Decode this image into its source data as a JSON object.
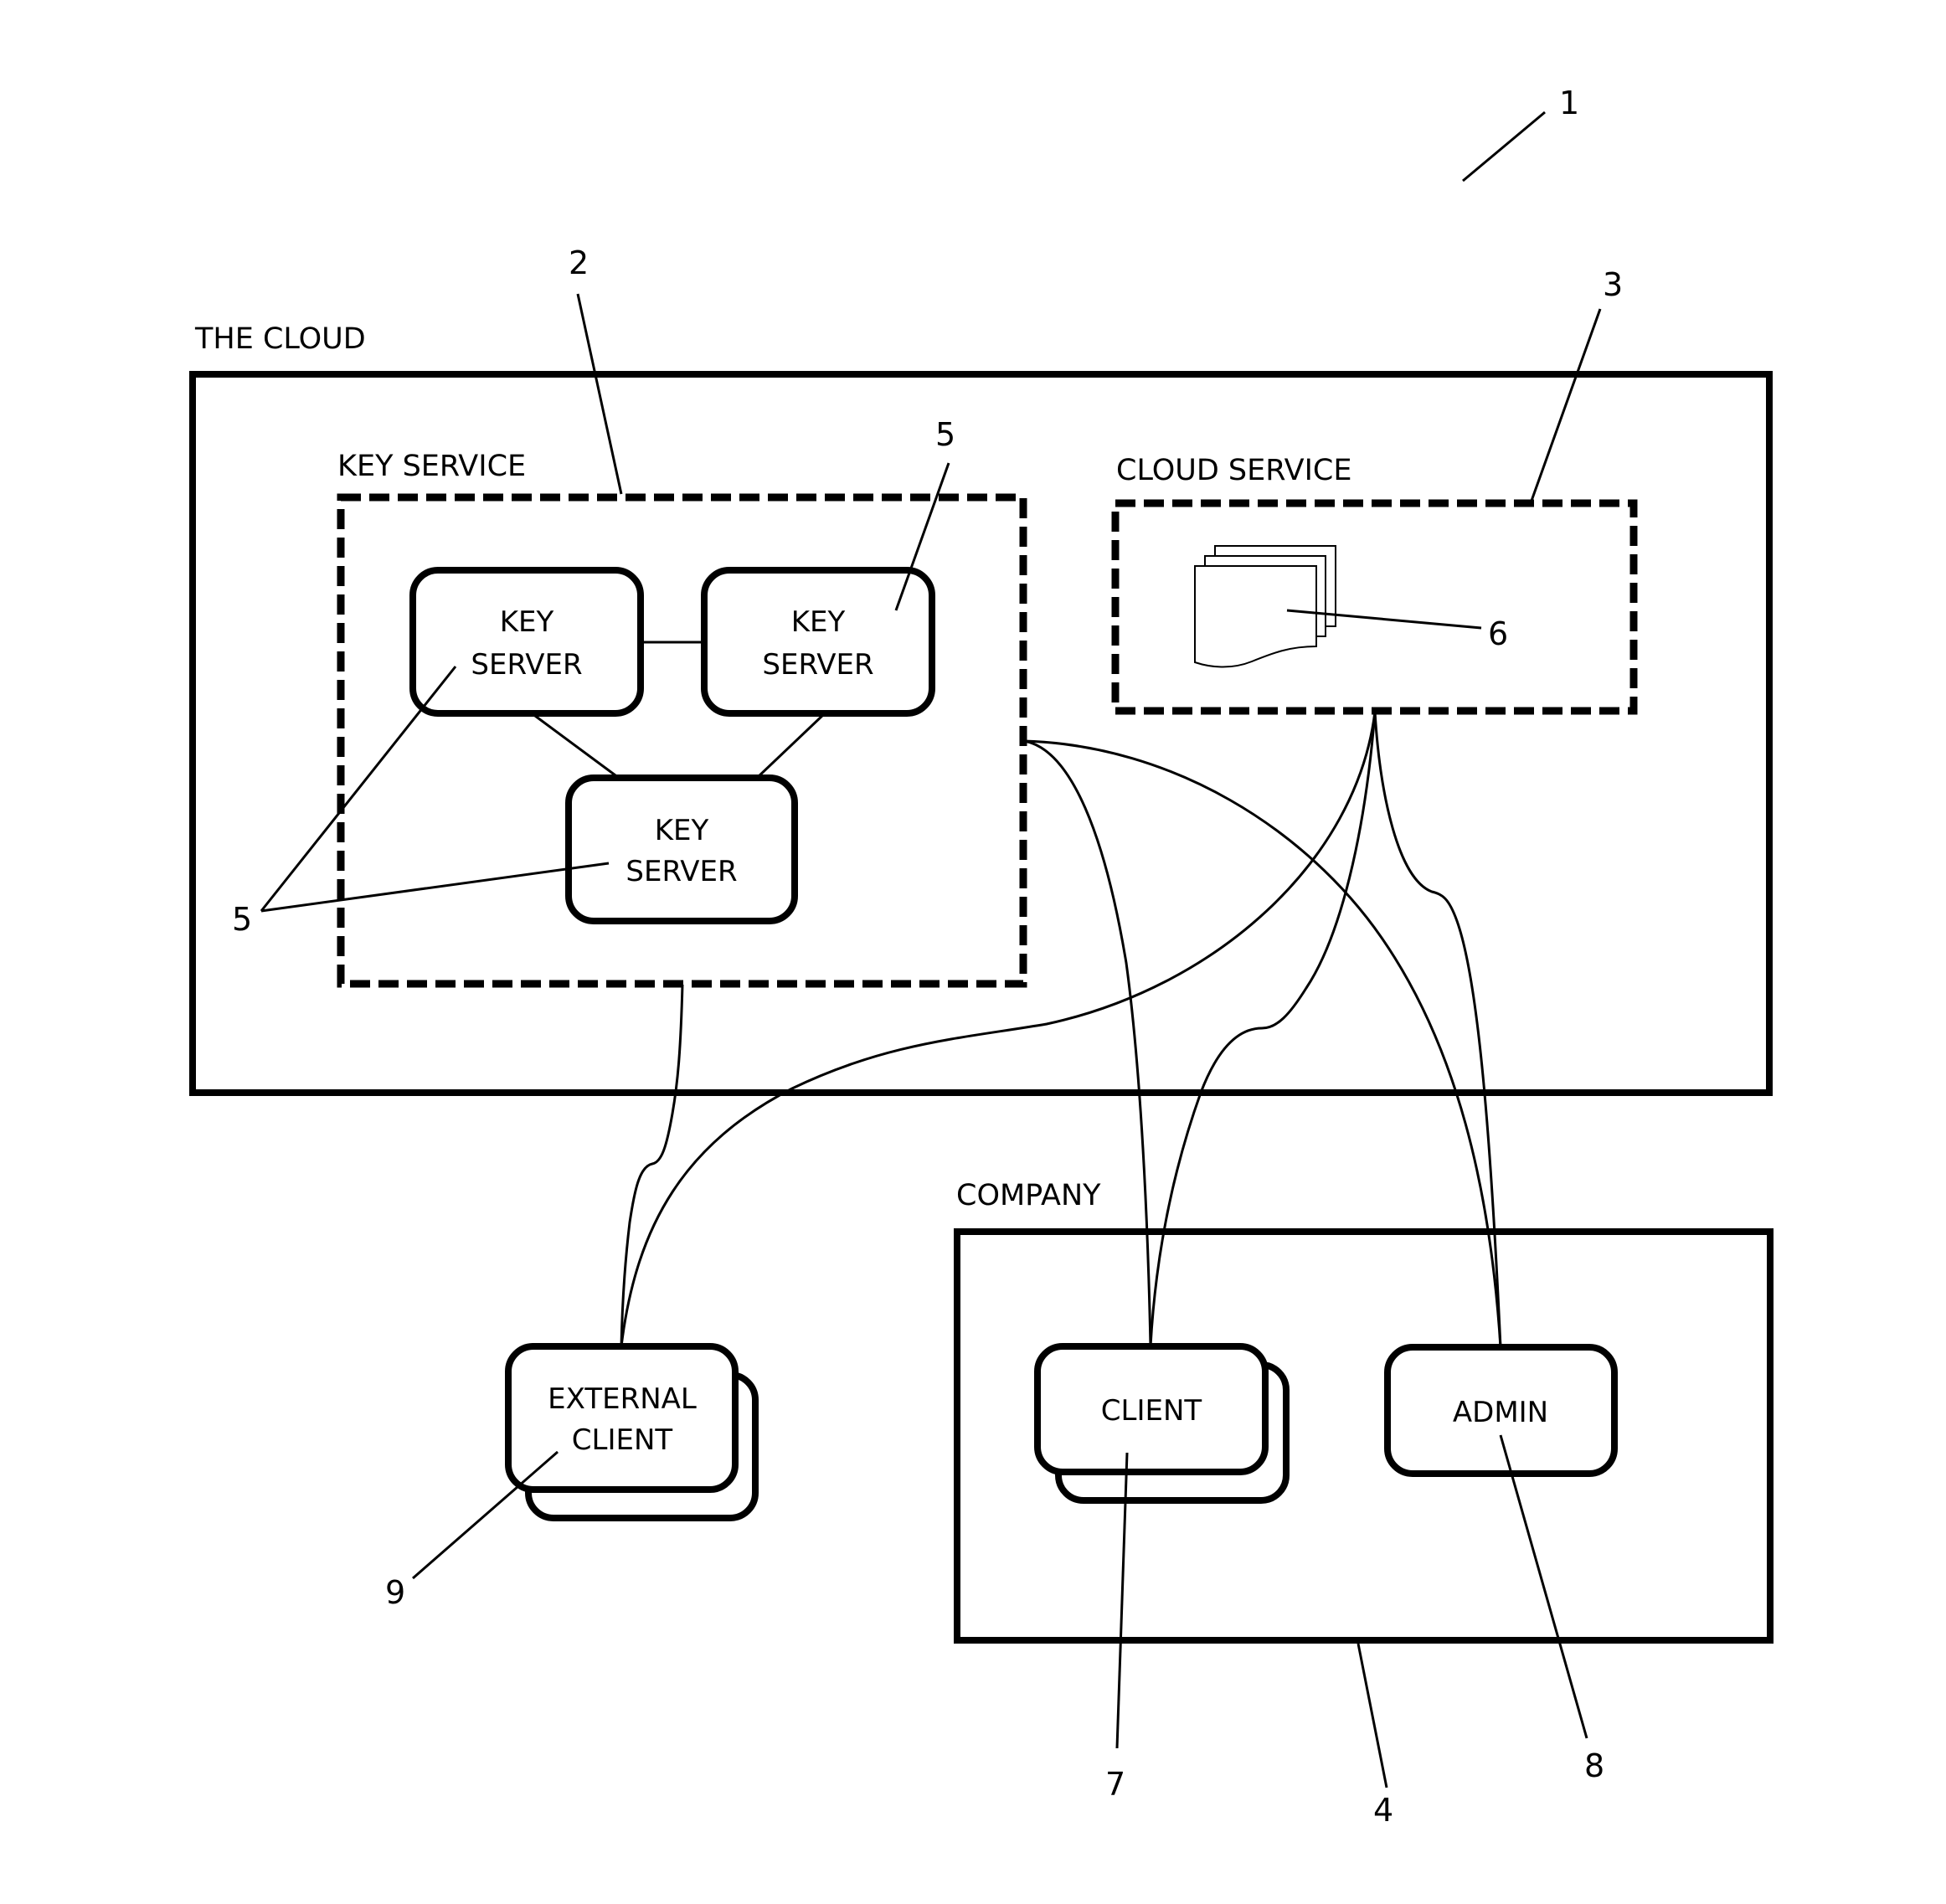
{
  "figure": {
    "reference": "1",
    "cloud": {
      "label": "THE CLOUD",
      "key_service": {
        "label": "KEY SERVICE",
        "reference": "2",
        "servers": [
          {
            "line1": "KEY",
            "line2": "SERVER",
            "reference": "5"
          },
          {
            "line1": "KEY",
            "line2": "SERVER",
            "reference": "5"
          },
          {
            "line1": "KEY",
            "line2": "SERVER",
            "reference": "5"
          }
        ],
        "server_reference_top": "5",
        "server_reference_left": "5"
      },
      "cloud_service": {
        "label": "CLOUD SERVICE",
        "reference": "3",
        "documents_reference": "6"
      }
    },
    "company": {
      "label": "COMPANY",
      "reference": "4",
      "client": {
        "label": "CLIENT",
        "reference": "7"
      },
      "admin": {
        "label": "ADMIN",
        "reference": "8"
      }
    },
    "external_client": {
      "line1": "EXTERNAL",
      "line2": "CLIENT",
      "reference": "9"
    }
  }
}
